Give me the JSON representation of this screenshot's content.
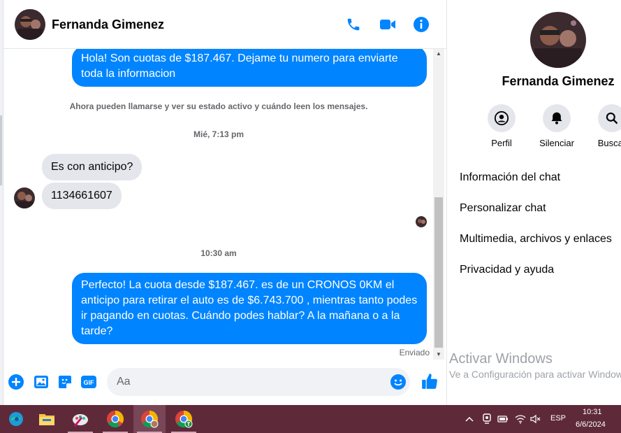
{
  "contact": {
    "name": "Fernanda Gimenez"
  },
  "header_actions": [
    "phone-icon",
    "video-icon",
    "info-icon"
  ],
  "messages": {
    "out_1": "Hola! Son cuotas de $187.467. Dejame tu numero para enviarte toda la informacion",
    "system_notice": "Ahora pueden llamarse y ver su estado activo y cuándo leen los mensajes.",
    "time_1": "Mié, 7:13 pm",
    "in_1": "Es con anticipo?",
    "in_2": "1134661607",
    "time_2": "10:30 am",
    "out_2": "Perfecto! La cuota desde $187.467. es de un CRONOS 0KM el anticipo para retirar el auto es de $6.743.700 , mientras tanto podes ir pagando en cuotas. Cuándo podes hablar? A la mañana o a la tarde?",
    "status": "Enviado"
  },
  "composer": {
    "placeholder": "Aa",
    "gif_label": "GIF"
  },
  "panel": {
    "name": "Fernanda Gimenez",
    "actions": [
      {
        "label": "Perfil",
        "icon": "profile-icon"
      },
      {
        "label": "Silenciar",
        "icon": "bell-icon"
      },
      {
        "label": "Buscar",
        "icon": "search-icon"
      }
    ],
    "items": [
      "Información del chat",
      "Personalizar chat",
      "Multimedia, archivos y enlaces",
      "Privacidad y ayuda"
    ]
  },
  "watermark": {
    "title": "Activar Windows",
    "subtitle": "Ve a Configuración para activar Windows."
  },
  "taskbar": {
    "apps": [
      "edge-icon",
      "file-explorer-icon",
      "paint-icon",
      "chrome-icon",
      "chrome-profile-icon",
      "chrome-profile-t-icon"
    ],
    "language": "ESP",
    "time": "10:31",
    "date": "6/6/2024"
  },
  "colors": {
    "accent": "#0084ff",
    "bubble_in": "#e4e6eb",
    "taskbar": "#5e2a3a"
  }
}
